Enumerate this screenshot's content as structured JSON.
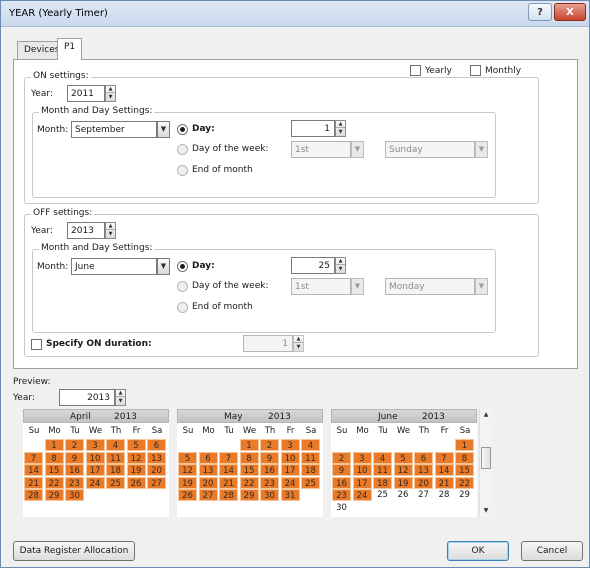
{
  "window": {
    "title": "YEAR (Yearly Timer)",
    "help": "?",
    "close": "X"
  },
  "tabs": [
    {
      "label": "Devices"
    },
    {
      "label": "P1"
    }
  ],
  "top_checks": {
    "yearly": "Yearly",
    "monthly": "Monthly"
  },
  "on": {
    "group_label": "ON settings:",
    "year_label": "Year:",
    "year": "2011",
    "md_label": "Month and Day Settings:",
    "month_label": "Month:",
    "month": "September",
    "day_label": "Day:",
    "day": "1",
    "dow_label": "Day of the week:",
    "dow_nth": "1st",
    "dow_day": "Sunday",
    "eom_label": "End of month"
  },
  "off": {
    "group_label": "OFF settings:",
    "year_label": "Year:",
    "year": "2013",
    "md_label": "Month and Day Settings:",
    "month_label": "Month:",
    "month": "June",
    "day_label": "Day:",
    "day": "25",
    "dow_label": "Day of the week:",
    "dow_nth": "1st",
    "dow_day": "Monday",
    "eom_label": "End of month"
  },
  "duration": {
    "label": "Specify ON duration:",
    "value": "1"
  },
  "preview": {
    "label": "Preview:",
    "year_label": "Year:",
    "year": "2013",
    "dow": [
      "Su",
      "Mo",
      "Tu",
      "We",
      "Th",
      "Fr",
      "Sa"
    ],
    "calendars": [
      {
        "month": "April",
        "year": "2013",
        "weeks": [
          [
            "",
            "1",
            "2",
            "3",
            "4",
            "5",
            "6"
          ],
          [
            "7",
            "8",
            "9",
            "10",
            "11",
            "12",
            "13"
          ],
          [
            "14",
            "15",
            "16",
            "17",
            "18",
            "19",
            "20"
          ],
          [
            "21",
            "22",
            "23",
            "24",
            "25",
            "26",
            "27"
          ],
          [
            "28",
            "29",
            "30",
            "",
            "",
            "",
            ""
          ]
        ],
        "highlight_until": 30
      },
      {
        "month": "May",
        "year": "2013",
        "weeks": [
          [
            "",
            "",
            "",
            "1",
            "2",
            "3",
            "4"
          ],
          [
            "5",
            "6",
            "7",
            "8",
            "9",
            "10",
            "11"
          ],
          [
            "12",
            "13",
            "14",
            "15",
            "16",
            "17",
            "18"
          ],
          [
            "19",
            "20",
            "21",
            "22",
            "23",
            "24",
            "25"
          ],
          [
            "26",
            "27",
            "28",
            "29",
            "30",
            "31",
            ""
          ]
        ],
        "highlight_until": 31
      },
      {
        "month": "June",
        "year": "2013",
        "weeks": [
          [
            "",
            "",
            "",
            "",
            "",
            "",
            "1"
          ],
          [
            "2",
            "3",
            "4",
            "5",
            "6",
            "7",
            "8"
          ],
          [
            "9",
            "10",
            "11",
            "12",
            "13",
            "14",
            "15"
          ],
          [
            "16",
            "17",
            "18",
            "19",
            "20",
            "21",
            "22"
          ],
          [
            "23",
            "24",
            "25",
            "26",
            "27",
            "28",
            "29"
          ],
          [
            "30",
            "",
            "",
            "",
            "",
            "",
            ""
          ]
        ],
        "highlight_until": 24
      }
    ]
  },
  "buttons": {
    "data_register": "Data Register Allocation",
    "ok": "OK",
    "cancel": "Cancel"
  },
  "colors": {
    "highlight": "#e87a2a",
    "title_bg": "#c9d9ed",
    "close": "#c7432c"
  }
}
